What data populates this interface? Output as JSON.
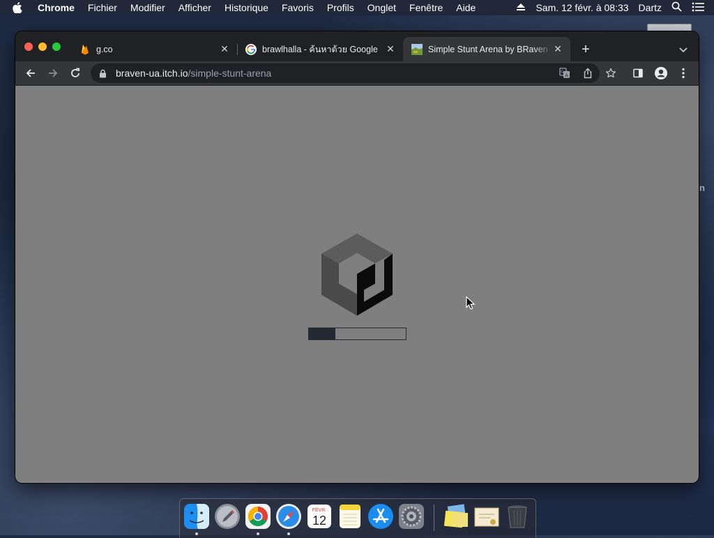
{
  "menubar": {
    "app_name": "Chrome",
    "items": [
      "Fichier",
      "Modifier",
      "Afficher",
      "Historique",
      "Favoris",
      "Profils",
      "Onglet",
      "Fenêtre",
      "Aide"
    ],
    "datetime": "Sam. 12 févr. à  08:33",
    "user": "Dartz"
  },
  "desktop": {
    "peek_text": "n"
  },
  "browser": {
    "tabs": [
      {
        "title": "g.co",
        "favicon": "firebase-flame-icon"
      },
      {
        "title": "brawlhalla - ค้นหาด้วย Google",
        "favicon": "google-g-icon"
      },
      {
        "title": "Simple Stunt Arena by BRaven",
        "favicon": "game-thumbnail-icon",
        "active": true
      }
    ],
    "address": {
      "host": "braven-ua.itch.io",
      "path": "/simple-stunt-arena"
    },
    "accent": "#35363a"
  },
  "content": {
    "loader": {
      "logo": "unity-logo-icon",
      "progress": 0.27
    },
    "background": "#7f7f7f"
  },
  "dock": {
    "apps": [
      "Finder",
      "Launchpad",
      "Google Chrome",
      "Safari",
      "Calendar",
      "Notes",
      "App Store",
      "System Preferences",
      "Stickies",
      "Certificate",
      "Trash"
    ],
    "calendar": {
      "month": "FÉVR.",
      "day": "12"
    }
  }
}
